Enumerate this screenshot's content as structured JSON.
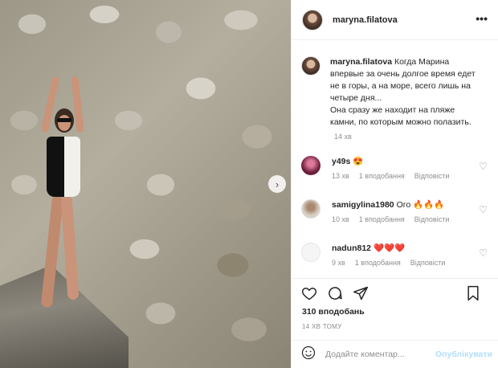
{
  "post": {
    "username": "maryna.filatova",
    "caption": "Когда Марина впервые за очень долгое время едет не в горы, а на море, всего лишь на четыре дня... Она сразу же находит на пляже камни, по которым можно полазить.",
    "caption_line1": "Когда Марина",
    "caption_line2": "впервые за очень долгое время едет",
    "caption_line3": "не в горы, а на море, всего лишь на",
    "caption_line4": "четыре дня...",
    "caption_line5": "Она сразу же находит на пляже",
    "caption_line6": "камни, по которым можно полазить.",
    "caption_time": "14 хв",
    "likes": "310 вподобань",
    "posted_time": "14 ХВ ТОМУ"
  },
  "comments": [
    {
      "username": "y49s",
      "text": "😍",
      "time": "13 хв",
      "likes": "1 вподобання",
      "reply": "Відповісти",
      "avatar_color": "#6b1e3a"
    },
    {
      "username": "samigylina1980",
      "text": "Ого 🔥🔥🔥",
      "time": "10 хв",
      "likes": "1 вподобання",
      "reply": "Відповісти",
      "avatar_color": "#c9b8a8"
    },
    {
      "username": "nadun812",
      "text": "❤️❤️❤️",
      "time": "9 хв",
      "likes": "1 вподобання",
      "reply": "Відповісти",
      "avatar_color": "#f2f2f2"
    }
  ],
  "comment_bar": {
    "placeholder": "Додайте коментар...",
    "post_label": "Опублікувати"
  },
  "icons": {
    "more": "more-options-icon",
    "like": "heart-icon",
    "comment": "comment-icon",
    "share": "share-icon",
    "save": "bookmark-icon",
    "emoji": "emoji-icon",
    "next": "chevron-right-icon"
  }
}
